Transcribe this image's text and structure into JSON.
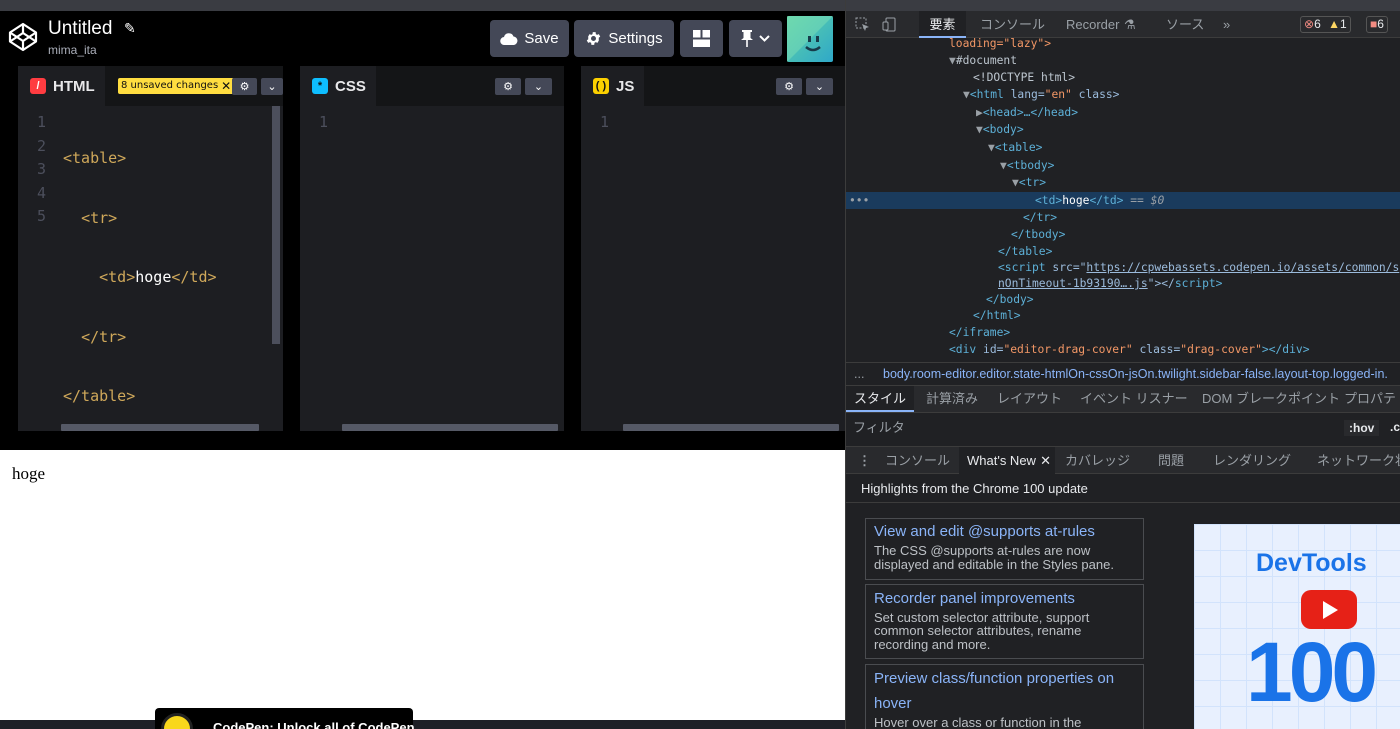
{
  "codepen": {
    "title": "Untitled",
    "user": "mima_ita",
    "buttons": {
      "save": "Save",
      "settings": "Settings"
    },
    "panes": {
      "html": {
        "label": "HTML",
        "unsaved": "8 unsaved changes"
      },
      "css": {
        "label": "CSS"
      },
      "js": {
        "label": "JS"
      }
    },
    "html_lines": [
      "1",
      "2",
      "3",
      "4",
      "5"
    ],
    "css_lines": [
      "1"
    ],
    "js_lines": [
      "1"
    ],
    "preview_text": "hoge",
    "toast_text": "CodePen: Unlock all of CodePen"
  },
  "devtools": {
    "tabs": [
      "要素",
      "コンソール",
      "Recorder",
      "ソース",
      "»"
    ],
    "badges": {
      "errors": "6",
      "warnings": "1",
      "issues": "6"
    },
    "dom_lines": {
      "l0": "loading=\"lazy\">",
      "l1": "#document",
      "l2": "<!DOCTYPE html>",
      "l3a": "<html",
      "l3b": " lang=",
      "l3c": "\"en\"",
      "l3d": " class>",
      "l4": "<head>…</head>",
      "l5": "<body>",
      "l6": "<table>",
      "l7": "<tbody>",
      "l8": "<tr>",
      "l9a": "<td>",
      "l9b": "hoge",
      "l9c": "</td>",
      "l9d": " == $0",
      "l10": "</tr>",
      "l11": "</tbody>",
      "l12": "</table>",
      "l13a": "<script",
      "l13b": " src=\"",
      "l13c": "https://cpwebassets.codepen.io/assets/common/s",
      "l14a": "nOnTimeout-1b93190….js",
      "l14b": "\"></",
      "l14c": "script>",
      "l15": "</body>",
      "l16": "</html>",
      "l17": "</iframe>",
      "l18a": "<div",
      "l18b": " id=",
      "l18c": "\"editor-drag-cover\"",
      "l18d": " class=",
      "l18e": "\"drag-cover\"",
      "l18f": "></div>"
    },
    "breadcrumb_prefix": "...",
    "breadcrumb_tag": "body",
    "breadcrumb": ".room-editor.editor.state-htmlOn-cssOn-jsOn.twilight.sidebar-false.layout-top.logged-in.",
    "styles_tabs": [
      "スタイル",
      "計算済み",
      "レイアウト",
      "イベント リスナー",
      "DOM ブレークポイント",
      "プロパテ"
    ],
    "filter_placeholder": "フィルタ",
    "filter_hov": ":hov",
    "filter_cls": ".c",
    "drawer_tabs": [
      "コンソール",
      "What's New",
      "カバレッジ",
      "問題",
      "レンダリング",
      "ネットワーク状"
    ],
    "whats_new_heading": "Highlights from the Chrome 100 update",
    "cards": [
      {
        "title": "View and edit @supports at-rules",
        "desc1": "The CSS @supports at-rules are now",
        "desc2": "displayed and editable in the Styles pane.",
        "desc3": ""
      },
      {
        "title": "Recorder panel improvements",
        "desc1": "Set custom selector attribute, support",
        "desc2": "common selector attributes, rename",
        "desc3": "recording and more."
      },
      {
        "title": "Preview class/function properties on",
        "title2": "hover",
        "desc1": "Hover over a class or function in the"
      }
    ],
    "promo_title": "DevTools",
    "promo_number": "100"
  },
  "colors": {
    "accent": "#8ab4f8",
    "tag": "#cfa85a",
    "unsaved_badge": "#ffdd40"
  }
}
